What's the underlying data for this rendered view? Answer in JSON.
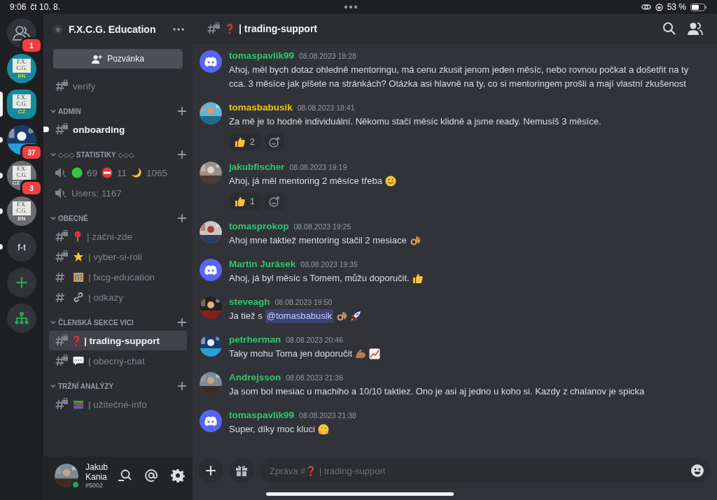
{
  "status_bar": {
    "time": "9:06",
    "date": "čt 10. 8.",
    "battery": "53 %"
  },
  "servers": [
    {
      "kind": "friends",
      "badge": "1",
      "selected": false,
      "unread": false
    },
    {
      "kind": "logo",
      "logo_text": "F.X. C.G.",
      "tag": "EN",
      "color": "#168a9e",
      "selected": false,
      "unread": false
    },
    {
      "kind": "logo",
      "logo_text": "F.X. C.G.",
      "tag": "CZ",
      "color": "#168a9e",
      "selected": true,
      "unread": false
    },
    {
      "kind": "picture",
      "badge": "37",
      "selected": false,
      "unread": true
    },
    {
      "kind": "logo",
      "logo_text": "F.X. C.G.",
      "tag": "CZ",
      "color": "#6b6d70",
      "badge": "3",
      "selected": false,
      "unread": true
    },
    {
      "kind": "logo",
      "logo_text": "F.X. C.G.",
      "tag": "EN",
      "color": "#6b6d70",
      "selected": false,
      "unread": true
    },
    {
      "kind": "text",
      "label": "f-t",
      "selected": false,
      "unread": true
    },
    {
      "kind": "add",
      "selected": false,
      "unread": false
    },
    {
      "kind": "hub",
      "selected": false,
      "unread": false
    }
  ],
  "server": {
    "boosts": "0",
    "name": "F.X.C.G. Education",
    "invite": "Pozvánka"
  },
  "top_channels": [
    {
      "kind": "locked",
      "name": "verify",
      "selected": false,
      "unread": false
    }
  ],
  "categories": [
    {
      "name": "ADMIN",
      "expanded": true,
      "channels": [
        {
          "kind": "locked",
          "name": "onboarding",
          "selected": false,
          "unread": true
        }
      ]
    },
    {
      "name": "◇◇◇ STATISTIKY ◇◇◇",
      "expanded": true,
      "channels": [
        {
          "kind": "voice",
          "stats": [
            "69",
            "11",
            "1065"
          ],
          "selected": false,
          "unread": false
        },
        {
          "kind": "voice",
          "name": "Users: 1167",
          "selected": false,
          "unread": false
        }
      ]
    },
    {
      "name": "OBECNÉ",
      "expanded": true,
      "channels": [
        {
          "kind": "locked",
          "name": "| začni-zde",
          "selected": false,
          "unread": false
        },
        {
          "kind": "locked",
          "name": "| vyber-si-roli",
          "selected": false,
          "unread": false
        },
        {
          "kind": "text",
          "name": "| fxcg-education",
          "selected": false,
          "unread": false
        },
        {
          "kind": "text",
          "name": "| odkazy",
          "selected": false,
          "unread": false
        }
      ]
    },
    {
      "name": "ČLENSKÁ SEKCE VICI",
      "expanded": true,
      "channels": [
        {
          "kind": "locked",
          "name": "| trading-support",
          "selected": true,
          "unread": false
        },
        {
          "kind": "locked",
          "name": "| obecný-chat",
          "selected": false,
          "unread": false
        }
      ]
    },
    {
      "name": "TRŽNÍ ANALÝZY",
      "expanded": true,
      "channels": [
        {
          "kind": "locked",
          "name": "| užitečné-info",
          "selected": false,
          "unread": false
        }
      ]
    }
  ],
  "user": {
    "name": "Jakub Kania",
    "tag": "#5002",
    "online": true
  },
  "header": {
    "name": "| trading-support"
  },
  "messages": [
    {
      "author": "tomaspavlik99",
      "color": "#2dc770",
      "time": "08.08.2023 18:28",
      "text": "Ahoj, měl bych dotaz ohledně mentoringu, má cenu zkusit jenom jeden měsíc, nebo rovnou počkat a došetřit na ty cca. 3 měsíce jak píšete na stránkách? Otázka asi hlavně na ty, co si mentoringem prošli a mají vlastní zkušenost"
    },
    {
      "author": "tomasbabusik",
      "color": "#f1c40f",
      "time": "08.08.2023 18:41",
      "text": "Za mě je to hodně individuální. Někomu stačí měsíc klidně a jsme ready. Nemusíš 3 měsíce.",
      "reactions": [
        "2"
      ]
    },
    {
      "author": "jakubfischer",
      "color": "#2dc770",
      "time": "08.08.2023 19:19",
      "text": "Ahoj, já měl mentoring 2 měsíce třeba",
      "reactions": [
        "1"
      ]
    },
    {
      "author": "tomasprokop",
      "color": "#2dc770",
      "time": "08.08.2023 19:25",
      "text": "Ahoj mne taktiež mentoring stačil 2 mesiace"
    },
    {
      "author": "Martin Jurásek",
      "color": "#2dc770",
      "time": "08.08.2023 19:35",
      "text": "Ahoj, já byl měsíc s Tomem, můžu doporučit."
    },
    {
      "author": "steveagh",
      "color": "#2dc770",
      "time": "08.08.2023 19:50",
      "text": "Ja tiež s",
      "mention": "@tomasbabusik"
    },
    {
      "author": "petrherman",
      "color": "#2dc770",
      "time": "08.08.2023 20:46",
      "text": "Taky mohu Toma jen doporučit"
    },
    {
      "author": "Andrejsson",
      "color": "#2dc770",
      "time": "08.08.2023 21:36",
      "text": "Ja som bol mesiac u machiho a 10/10 taktiez. Ono je asi aj jedno u koho si. Kazdy z chalanov je spicka"
    },
    {
      "author": "tomaspavlik99",
      "color": "#2dc770",
      "time": "08.08.2023 21:38",
      "text": "Super, díky moc kluci"
    }
  ],
  "composer": {
    "placeholder": "Zpráva #❓ | trading-support"
  }
}
